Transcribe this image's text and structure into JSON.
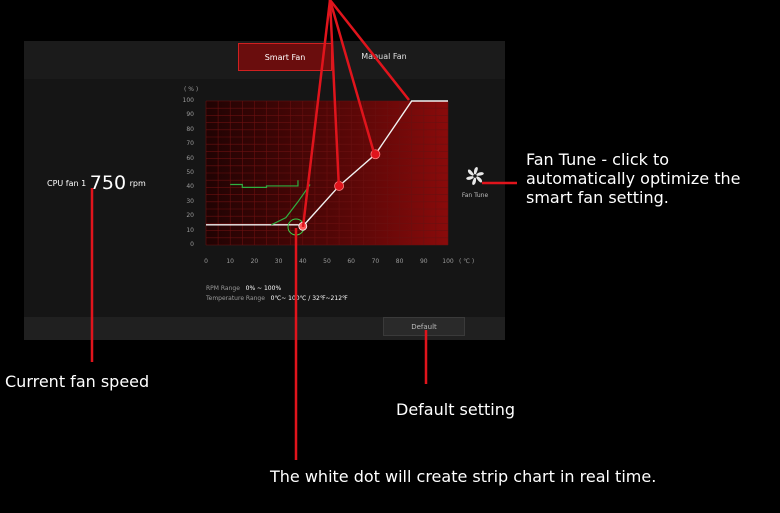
{
  "tabs": [
    {
      "label": "Smart Fan",
      "active": true
    },
    {
      "label": "Manual Fan",
      "active": false
    }
  ],
  "fan": {
    "name": "CPU fan 1",
    "speed": "750",
    "unit": "rpm"
  },
  "chart": {
    "y_unit": "( % )",
    "x_unit": "( ℃ )",
    "y_ticks": [
      "0",
      "10",
      "20",
      "30",
      "40",
      "50",
      "60",
      "70",
      "80",
      "90",
      "100"
    ],
    "x_ticks": [
      "0",
      "10",
      "20",
      "30",
      "40",
      "50",
      "60",
      "70",
      "80",
      "90",
      "100"
    ]
  },
  "chart_data": {
    "type": "line",
    "xlim": [
      0,
      100
    ],
    "ylim": [
      0,
      100
    ],
    "series": [
      {
        "values": [
          [
            0,
            14
          ],
          [
            38,
            14
          ],
          [
            40,
            13
          ],
          [
            55,
            41
          ],
          [
            70,
            63
          ],
          [
            85,
            100
          ],
          [
            100,
            100
          ]
        ]
      },
      {
        "values": [
          [
            10,
            42
          ],
          [
            15,
            42
          ],
          [
            15,
            40
          ],
          [
            25,
            40
          ],
          [
            25,
            41
          ],
          [
            38,
            41
          ],
          [
            38,
            45
          ]
        ]
      },
      {
        "values": [
          [
            27,
            14
          ],
          [
            33,
            19
          ],
          [
            38,
            30
          ],
          [
            43,
            42
          ]
        ]
      }
    ],
    "control_points": [
      [
        40,
        13
      ],
      [
        55,
        41
      ],
      [
        70,
        63
      ]
    ]
  },
  "range": {
    "rpm_label": "RPM Range",
    "rpm_value": "0% ~ 100%",
    "temp_label": "Temperature Range",
    "temp_value": "0℃~ 100℃ / 32℉~212℉"
  },
  "fan_tune_label": "Fan Tune",
  "default_label": "Default",
  "annotations": {
    "fan_tune": "Fan Tune - click to automatically optimize the smart fan setting.",
    "current_speed": "Current fan speed",
    "default_setting": "Default setting",
    "white_dot": "The white dot will create strip chart in real time."
  },
  "colors": {
    "accent": "#e0141c",
    "panel": "#151515",
    "grid": "#6a1010",
    "green": "#2fb040"
  }
}
